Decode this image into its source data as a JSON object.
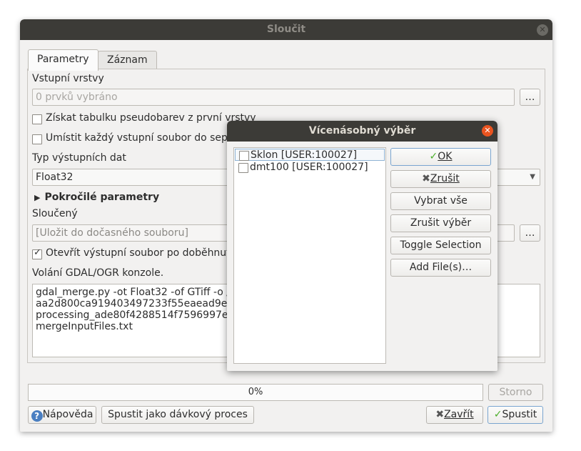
{
  "window": {
    "title": "Sloučit"
  },
  "tabs": [
    {
      "label": "Parametry"
    },
    {
      "label": "Záznam"
    }
  ],
  "params": {
    "input_layers_label": "Vstupní vrstvy",
    "input_layers_value": "0 prvků vybráno",
    "browse_label": "…",
    "pseudocolor_label": "Získat tabulku pseudobarev z první vrstvy",
    "separate_label": "Umístit každý vstupní soubor do sepa",
    "output_type_label": "Typ výstupních dat",
    "output_type_value": "Float32",
    "advanced_label": "Pokročilé parametry",
    "merged_label": "Sloučený",
    "merged_placeholder": "[Uložit do dočasného souboru]",
    "open_output_label": "Otevřít výstupní soubor po doběhnut",
    "console_label": "Volání GDAL/OGR konzole.",
    "console_lines": [
      "gdal_merge.py -ot Float32 -of GTiff -o /t",
      "aa2d800ca919403497233f55eaead9e1/",
      "processing_ade80f4288514f7596997e3",
      "mergeInputFiles.txt"
    ]
  },
  "progress": {
    "text": "0%"
  },
  "footer": {
    "cancel_label": "Storno",
    "help_label": "Nápověda",
    "batch_label": "Spustit jako dávkový proces",
    "close_label": "Zavřít",
    "run_label": "Spustit"
  },
  "dialog": {
    "title": "Vícenásobný výběr",
    "items": [
      {
        "label": "Sklon [USER:100027]"
      },
      {
        "label": "dmt100 [USER:100027]"
      }
    ],
    "ok_label": "OK",
    "cancel_label": "Zrušit",
    "select_all_label": "Vybrat vše",
    "deselect_label": "Zrušit výběr",
    "toggle_label": "Toggle Selection",
    "add_files_label": "Add File(s)…"
  },
  "colors": {
    "titlebar": "#3c3b37",
    "close_accent": "#e95420",
    "ok_check": "#4caf2b"
  }
}
